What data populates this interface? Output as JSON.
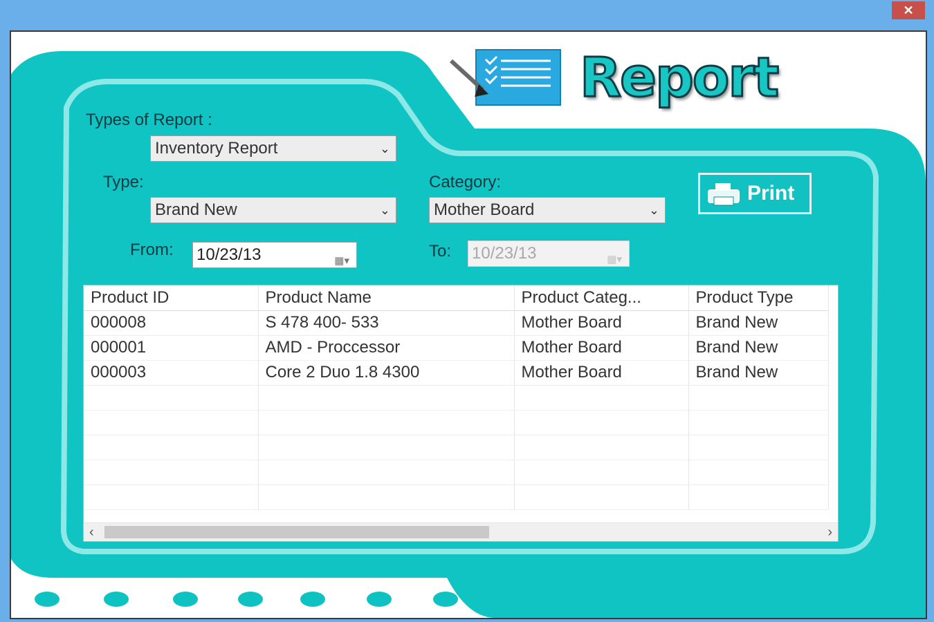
{
  "window": {
    "close_glyph": "✕"
  },
  "header": {
    "title": "Report",
    "icon": "report-document-icon"
  },
  "form": {
    "report_type_label": "Types of Report :",
    "report_type_value": "Inventory Report",
    "type_label": "Type:",
    "type_value": "Brand New",
    "category_label": "Category:",
    "category_value": "Mother Board",
    "from_label": "From:",
    "from_value": "10/23/13",
    "to_label": "To:",
    "to_value": "10/23/13"
  },
  "print_button": {
    "label": "Print",
    "icon": "printer-icon"
  },
  "table": {
    "columns": [
      "Product ID",
      "Product Name",
      "Product Categ...",
      "Product Type"
    ],
    "rows": [
      [
        "000008",
        "S 478 400- 533",
        "Mother Board",
        "Brand New"
      ],
      [
        "000001",
        "AMD - Proccessor",
        "Mother Board",
        "Brand New"
      ],
      [
        "000003",
        "Core 2 Duo 1.8 4300",
        "Mother Board",
        "Brand New"
      ]
    ]
  },
  "scrollbar": {
    "left_arrow": "‹",
    "right_arrow": "›"
  },
  "colors": {
    "accent": "#10c4c4",
    "accent_light": "#8ee8e8",
    "title_bar": "#6aaeea",
    "close": "#c7504a"
  }
}
